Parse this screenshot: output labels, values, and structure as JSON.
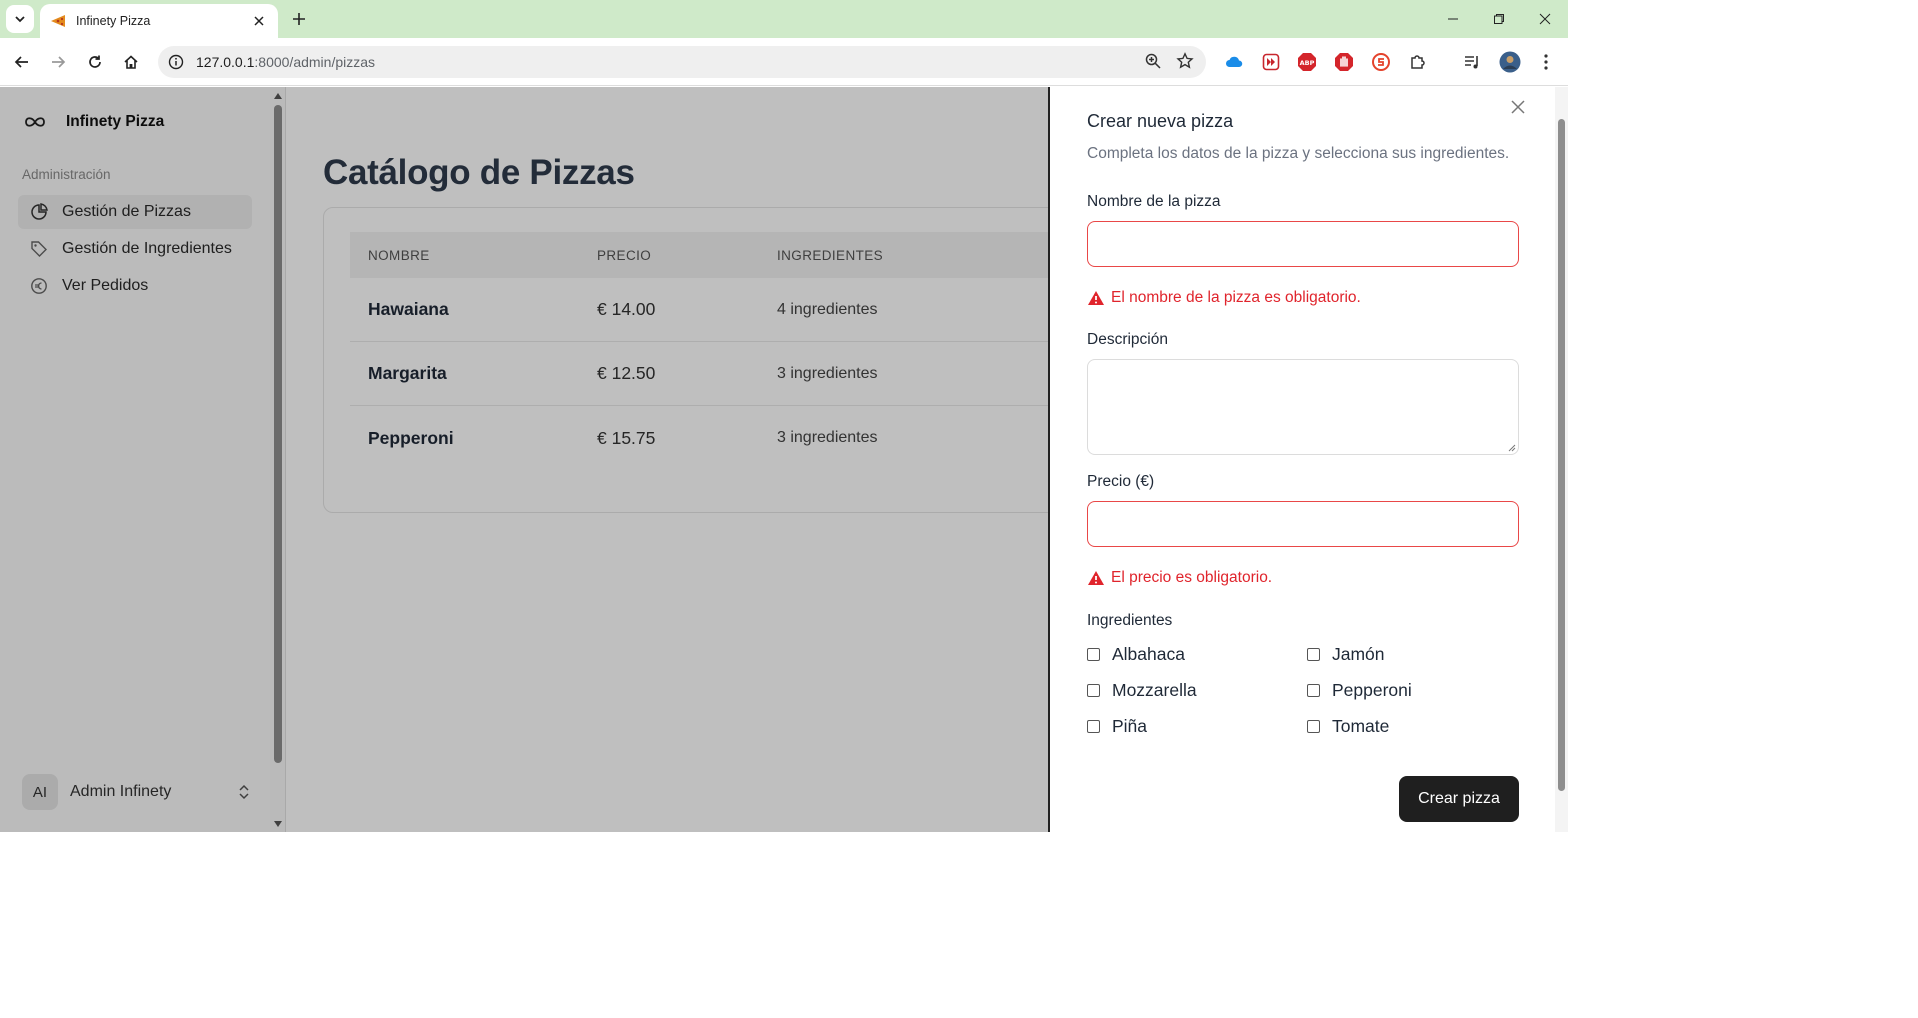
{
  "browser": {
    "tab_title": "Infinety Pizza",
    "url_host": "127.0.0.1",
    "url_path": ":8000/admin/pizzas"
  },
  "sidebar": {
    "brand": "Infinety Pizza",
    "section": "Administración",
    "items": [
      {
        "label": "Gestión de Pizzas",
        "icon": "pie-chart-icon"
      },
      {
        "label": "Gestión de Ingredientes",
        "icon": "tag-icon"
      },
      {
        "label": "Ver Pedidos",
        "icon": "euro-icon"
      }
    ],
    "user": {
      "initials": "AI",
      "name": "Admin Infinety"
    }
  },
  "main": {
    "title": "Catálogo de Pizzas",
    "columns": [
      "NOMBRE",
      "PRECIO",
      "INGREDIENTES"
    ],
    "rows": [
      {
        "name": "Hawaiana",
        "price": "€ 14.00",
        "ingredients": "4 ingredientes"
      },
      {
        "name": "Margarita",
        "price": "€ 12.50",
        "ingredients": "3 ingredientes"
      },
      {
        "name": "Pepperoni",
        "price": "€ 15.75",
        "ingredients": "3 ingredientes"
      }
    ]
  },
  "drawer": {
    "title": "Crear nueva pizza",
    "subtitle": "Completa los datos de la pizza y selecciona sus ingredientes.",
    "name_label": "Nombre de la pizza",
    "name_value": "",
    "name_error": "El nombre de la pizza es obligatorio.",
    "description_label": "Descripción",
    "description_value": "",
    "price_label": "Precio (€)",
    "price_value": "",
    "price_error": "El precio es obligatorio.",
    "ingredients_label": "Ingredientes",
    "ingredients": [
      "Albahaca",
      "Jamón",
      "Mozzarella",
      "Pepperoni",
      "Piña",
      "Tomate"
    ],
    "submit_label": "Crear pizza"
  },
  "colors": {
    "error": "#e0242c",
    "primary_button": "#1f1f1f",
    "tab_strip": "#cfeac9"
  }
}
